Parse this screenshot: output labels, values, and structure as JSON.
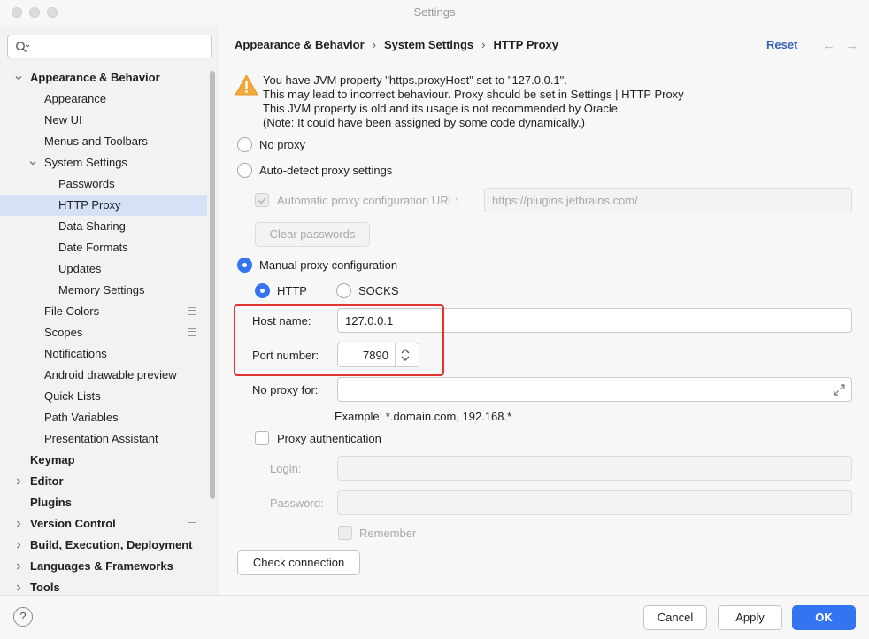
{
  "window": {
    "title": "Settings"
  },
  "search": {
    "placeholder": ""
  },
  "tree": [
    {
      "label": "Appearance & Behavior",
      "bold": true,
      "expanded": true,
      "indent": 0
    },
    {
      "label": "Appearance",
      "indent": 1
    },
    {
      "label": "New UI",
      "indent": 1
    },
    {
      "label": "Menus and Toolbars",
      "indent": 1
    },
    {
      "label": "System Settings",
      "indent": 1,
      "expanded": true
    },
    {
      "label": "Passwords",
      "indent": 2
    },
    {
      "label": "HTTP Proxy",
      "indent": 2,
      "selected": true
    },
    {
      "label": "Data Sharing",
      "indent": 2
    },
    {
      "label": "Date Formats",
      "indent": 2
    },
    {
      "label": "Updates",
      "indent": 2
    },
    {
      "label": "Memory Settings",
      "indent": 2
    },
    {
      "label": "File Colors",
      "indent": 1,
      "badge": true
    },
    {
      "label": "Scopes",
      "indent": 1,
      "badge": true
    },
    {
      "label": "Notifications",
      "indent": 1
    },
    {
      "label": "Android drawable preview",
      "indent": 1
    },
    {
      "label": "Quick Lists",
      "indent": 1
    },
    {
      "label": "Path Variables",
      "indent": 1
    },
    {
      "label": "Presentation Assistant",
      "indent": 1
    },
    {
      "label": "Keymap",
      "bold": true,
      "indent": 0
    },
    {
      "label": "Editor",
      "bold": true,
      "indent": 0,
      "collapsed": true
    },
    {
      "label": "Plugins",
      "bold": true,
      "indent": 0
    },
    {
      "label": "Version Control",
      "bold": true,
      "indent": 0,
      "collapsed": true,
      "badge": true
    },
    {
      "label": "Build, Execution, Deployment",
      "bold": true,
      "indent": 0,
      "collapsed": true
    },
    {
      "label": "Languages & Frameworks",
      "bold": true,
      "indent": 0,
      "collapsed": true
    },
    {
      "label": "Tools",
      "bold": true,
      "indent": 0,
      "collapsed": true
    }
  ],
  "breadcrumb": [
    "Appearance & Behavior",
    "System Settings",
    "HTTP Proxy"
  ],
  "header": {
    "reset_label": "Reset"
  },
  "warning": {
    "lines": [
      "You have JVM property \"https.proxyHost\" set to \"127.0.0.1\".",
      "This may lead to incorrect behaviour. Proxy should be set in Settings | HTTP Proxy",
      "This JVM property is old and its usage is not recommended by Oracle.",
      "(Note: It could have been assigned by some code dynamically.)"
    ]
  },
  "proxy": {
    "no_proxy_label": "No proxy",
    "auto_detect_label": "Auto-detect proxy settings",
    "auto_config_url_label": "Automatic proxy configuration URL:",
    "auto_config_url_value": "https://plugins.jetbrains.com/",
    "clear_passwords_label": "Clear passwords",
    "manual_label": "Manual proxy configuration",
    "http_label": "HTTP",
    "socks_label": "SOCKS",
    "host_label": "Host name:",
    "host_value": "127.0.0.1",
    "port_label": "Port number:",
    "port_value": "7890",
    "no_proxy_for_label": "No proxy for:",
    "no_proxy_for_value": "",
    "example_text": "Example: *.domain.com, 192.168.*",
    "auth_label": "Proxy authentication",
    "login_label": "Login:",
    "password_label": "Password:",
    "remember_label": "Remember",
    "check_connection_label": "Check connection"
  },
  "footer": {
    "help_label": "?",
    "cancel_label": "Cancel",
    "apply_label": "Apply",
    "ok_label": "OK"
  },
  "colors": {
    "accent": "#3574f0",
    "highlight_box": "#e0342f",
    "selection": "#d5e1f5"
  }
}
